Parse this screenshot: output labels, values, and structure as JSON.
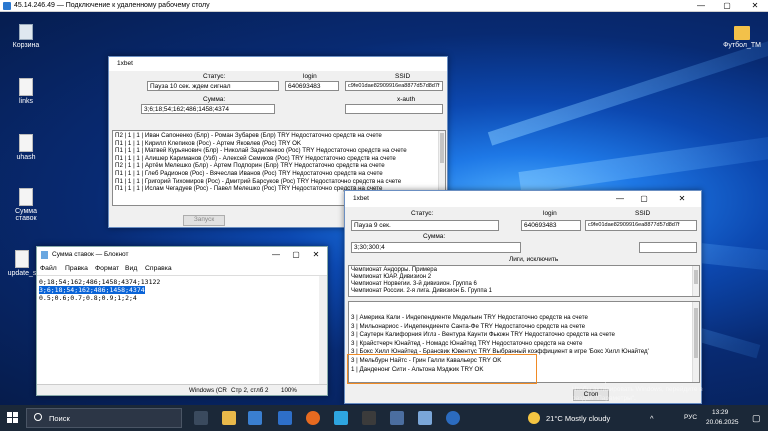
{
  "rdp": {
    "title": "45.14.246.49 — Подключение к удаленному рабочему столу",
    "min": "—",
    "max": "▢",
    "close": "✕"
  },
  "desktop_icons": [
    {
      "name": "recycle-bin-icon",
      "label": "Корзина"
    },
    {
      "name": "file-icon",
      "label": "links"
    },
    {
      "name": "file-icon",
      "label": "uhash"
    },
    {
      "name": "file-icon",
      "label": "Сумма ставок"
    },
    {
      "name": "file-icon",
      "label": "update_s"
    },
    {
      "name": "folder-icon",
      "label": "Футбол_TM"
    }
  ],
  "win1": {
    "title": "1xbet",
    "status_label": "Статус:",
    "status_value": "Пауза 10 сек. ждем сигнал",
    "login_label": "login",
    "login_value": "640693483",
    "ssid_label": "SSID",
    "ssid_value": "c9fe01dae82909916ea8877d57d8d7f",
    "sum_label": "Сумма:",
    "sum_value": "3;6;18;54;162;486;1458;4374",
    "xauth_label": "x-auth",
    "lines": [
      "П2 | 1 | 1 | Иван Сапоненко (Блр) - Роман Зубарев (Блр)  TRY  Недостаточно средств на счете",
      "П1 | 1 | 1 | Кирилл Клепиков (Рос) - Артем Яковлев (Рос)  TRY  OK",
      "П1 | 1 | 1 | Матвей Курьянович (Блр) - Николай Заделенкоо (Рос)  TRY  Недостаточно средств на счете",
      "П1 | 1 | 1 | Алишер Кариманов (Узб) - Алексей Семиков (Рос)  TRY  Недостаточно средств на счете",
      "П2 | 1 | 1 | Артём Мелешко (Блр) - Артем Подпорин (Блр)  TRY  Недостаточно средств на счете",
      "П1 | 1 | 1 | Глеб Радионов (Рос) - Вячеслав Иванов (Рос)  TRY  Недостаточно средств на счете",
      "П1 | 1 | 1 | Григорий Тихомиров (Рос) - Дмитрий Барсуков (Рос)  TRY  Недостаточно средств на счете",
      "П1 | 1 | 1 | Ислам Чегадуев (Рос) - Павел Мелешко (Рос)  TRY  Недостаточно средств на счете"
    ],
    "start_btn": "Запуск"
  },
  "notepad": {
    "title": "Сумма ставок — Блокнот",
    "menu": [
      "Файл",
      "Правка",
      "Формат",
      "Вид",
      "Справка"
    ],
    "lines": [
      "0;18;54;162;486;1458;4374;13122",
      "3;6;18;54;162;486;1458;4374",
      "0.5;0.6;0.7;0.8;0.9;1;2;4"
    ],
    "status_encoding": "Windows (CR",
    "status_pos": "Стр 2, стлб 2",
    "status_zoom": "100%"
  },
  "win2": {
    "title": "1xbet",
    "status_label": "Статус:",
    "status_value": "Пауза 9 сек.",
    "login_label": "login",
    "login_value": "640693483",
    "ssid_label": "SSID",
    "ssid_value": "c9fe01dae82909916ea8877d57d8d7f",
    "sum_label": "Сумма:",
    "sum_value": "3;30;300;4",
    "leagues_label": "Лиги, исключить",
    "leagues": [
      "Чемпионат Андорры. Примера",
      "Чемпионат ЮАР. Дивизион 2",
      "Чемпионат Норвегии. 3-й дивизион. Группа 6",
      "Чемпионат России. 2-я лига. Дивизион Б. Группа 1"
    ],
    "lines": [
      "3 | Америка Кали - Индепендиенте Медельин  TRY  Недостаточно средств на счете",
      "3 | Мильонариос - Индепендиенте Санта-Фе  TRY  Недостаточно средств на счете",
      "3 | Саутерн Калифорния Иглз - Вентура Каунти Фьюжн  TRY  Недостаточно средств на счете",
      "3 | Крайстчерч Юнайтед - Номадс Юнайтед  TRY  Недостаточно средств на счете",
      "3 | Бокс Хилл Юнайтед - Брансвик Ювентус  TRY  Выбранный коэффициент в игре 'Бокс Хилл Юнайтед'",
      "3 | Мельбурн Найтс - Грин Галли Кавальерс  TRY  OK",
      "1 | Данденонг Сити - Альтона Мэджик  TRY  OK"
    ],
    "stop_btn": "Стоп"
  },
  "activation": {
    "line1": "Активация Windows",
    "line2": "Чтобы активировать Windows, перейдите в",
    "line3": "раздел \"Параметры\"."
  },
  "taskbar": {
    "search": "Поиск",
    "weather": "21°C  Mostly cloudy",
    "lang": "РУС",
    "time": "13:29",
    "date": "20.06.2025"
  }
}
